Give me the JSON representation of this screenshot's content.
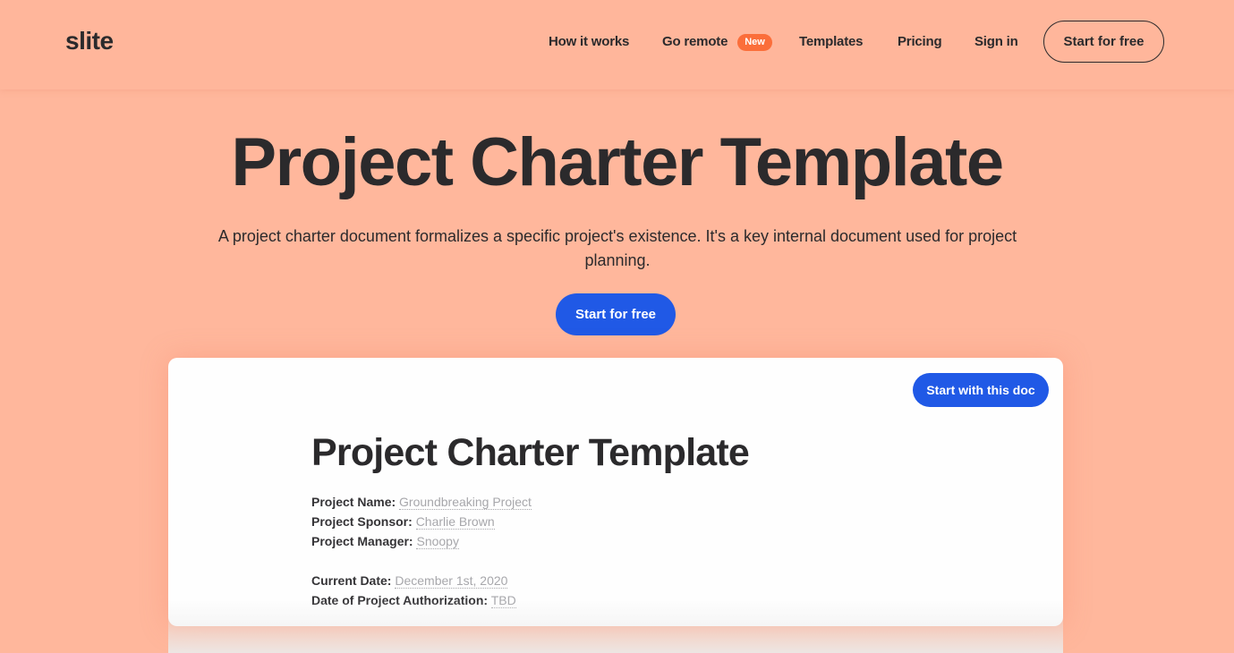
{
  "header": {
    "logo": "slite",
    "nav": [
      {
        "label": "How it works"
      },
      {
        "label": "Go remote",
        "badge": "New"
      },
      {
        "label": "Templates"
      },
      {
        "label": "Pricing"
      },
      {
        "label": "Sign in"
      }
    ],
    "cta_label": "Start for free"
  },
  "hero": {
    "title": "Project Charter Template",
    "subtitle": "A project charter document formalizes a specific project's existence. It's a key internal document used for project planning.",
    "cta_label": "Start for free"
  },
  "doc": {
    "cta_label": "Start with this doc",
    "title": "Project Charter Template",
    "fields": [
      {
        "label": "Project Name:",
        "value": "Groundbreaking Project"
      },
      {
        "label": "Project Sponsor:",
        "value": "Charlie Brown"
      },
      {
        "label": "Project Manager:",
        "value": "Snoopy"
      }
    ],
    "fields2": [
      {
        "label": "Current Date:",
        "value": "December 1st, 2020"
      },
      {
        "label": "Date of Project Authorization:",
        "value": "TBD"
      }
    ]
  },
  "colors": {
    "background": "#ffb79c",
    "primary_blue": "#2059e6",
    "badge_orange": "#fb6e3a",
    "text_dark": "#2b2a2c"
  }
}
